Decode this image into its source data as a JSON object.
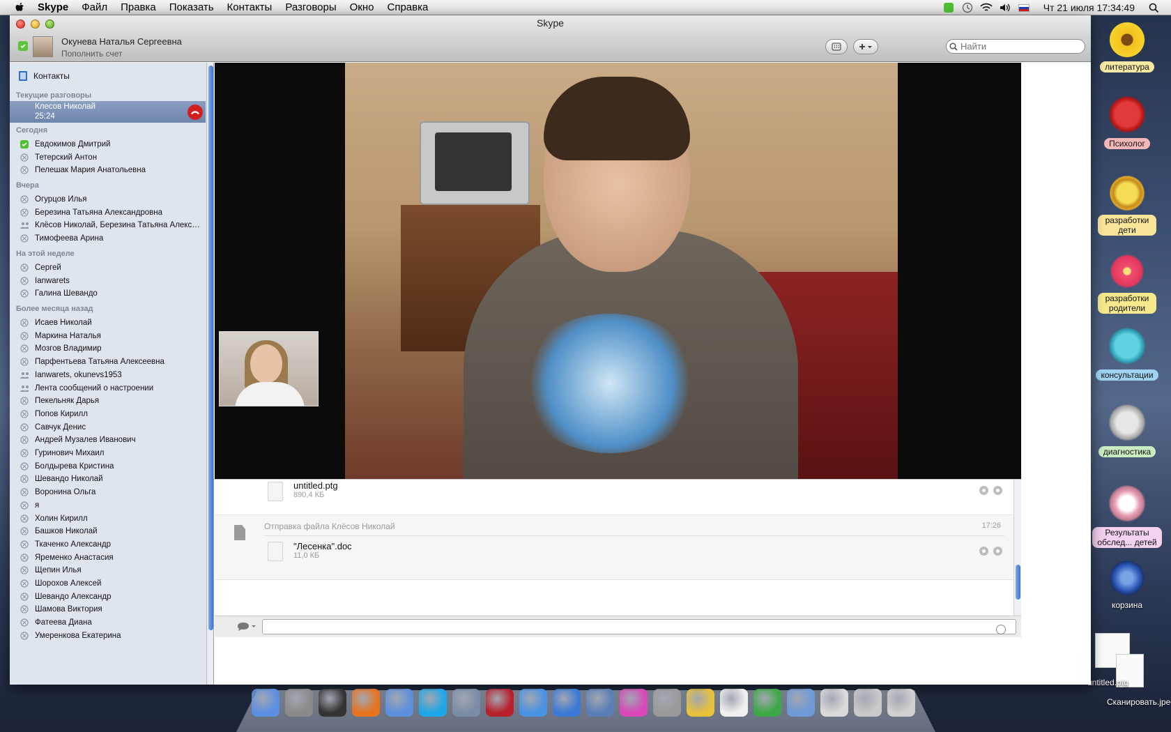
{
  "menubar": {
    "app_name": "Skype",
    "items": [
      "Файл",
      "Правка",
      "Показать",
      "Контакты",
      "Разговоры",
      "Окно",
      "Справка"
    ],
    "clock": "Чт 21 июля  17:34:49"
  },
  "window": {
    "title": "Skype",
    "user_name": "Окунева Наталья Сергеевна",
    "user_sub": "Пополнить счет",
    "search_placeholder": "Найти"
  },
  "sidebar": {
    "contacts_label": "Контакты",
    "current_header": "Текущие разговоры",
    "active_call": {
      "name": "Клесов Николай",
      "duration": "25:24"
    },
    "sections": [
      {
        "title": "Сегодня",
        "items": [
          {
            "label": "Евдокимов Дмитрий",
            "icon": "online-status-icon"
          },
          {
            "label": "Тетерский Антон",
            "icon": "call-history-icon"
          },
          {
            "label": "Пелешак Мария Анатольевна",
            "icon": "call-history-icon"
          }
        ]
      },
      {
        "title": "Вчера",
        "items": [
          {
            "label": "Огурцов Илья",
            "icon": "call-history-icon"
          },
          {
            "label": "Березина Татьяна Александровна",
            "icon": "call-history-icon"
          },
          {
            "label": "Клёсов Николай, Березина Татьяна Александровна",
            "icon": "group-chat-icon"
          },
          {
            "label": "Тимофеева Арина",
            "icon": "call-history-icon"
          }
        ]
      },
      {
        "title": "На этой неделе",
        "items": [
          {
            "label": "Сергей",
            "icon": "call-history-icon"
          },
          {
            "label": "Ianwarets",
            "icon": "call-history-icon"
          },
          {
            "label": "Галина Шевандо",
            "icon": "call-history-icon"
          }
        ]
      },
      {
        "title": "Более месяца назад",
        "items": [
          {
            "label": "Исаев Николай",
            "icon": "call-history-icon"
          },
          {
            "label": "Маркина Наталья",
            "icon": "call-history-icon"
          },
          {
            "label": "Мозгов Владимир",
            "icon": "call-history-icon"
          },
          {
            "label": "Парфентьева Татьяна Алексеевна",
            "icon": "call-history-icon"
          },
          {
            "label": "Ianwarets, okunevs1953",
            "icon": "group-chat-icon"
          },
          {
            "label": "Лента сообщений о настроении",
            "icon": "group-chat-icon"
          },
          {
            "label": "Пекельняк Дарья",
            "icon": "call-history-icon"
          },
          {
            "label": "Попов Кирилл",
            "icon": "call-history-icon"
          },
          {
            "label": "Савчук Денис",
            "icon": "call-history-icon"
          },
          {
            "label": "Андрей Музалев Иванович",
            "icon": "call-history-icon"
          },
          {
            "label": "Гуринович Михаил",
            "icon": "call-history-icon"
          },
          {
            "label": "Болдырева Кристина",
            "icon": "call-history-icon"
          },
          {
            "label": "Шевандо Николай",
            "icon": "call-history-icon"
          },
          {
            "label": "Воронина Ольга",
            "icon": "call-history-icon"
          },
          {
            "label": "я",
            "icon": "call-history-icon"
          },
          {
            "label": "Холин Кирилл",
            "icon": "call-history-icon"
          },
          {
            "label": "Башков Николай",
            "icon": "call-history-icon"
          },
          {
            "label": "Ткаченко Александр",
            "icon": "call-history-icon"
          },
          {
            "label": "Яременко Анастасия",
            "icon": "call-history-icon"
          },
          {
            "label": "Щепин Илья",
            "icon": "call-history-icon"
          },
          {
            "label": "Шорохов Алексей",
            "icon": "call-history-icon"
          },
          {
            "label": "Шевандо Александр",
            "icon": "call-history-icon"
          },
          {
            "label": "Шамова Виктория",
            "icon": "call-history-icon"
          },
          {
            "label": "Фатеева Диана",
            "icon": "call-history-icon"
          },
          {
            "label": "Умеренкова Екатерина",
            "icon": "call-history-icon"
          }
        ]
      }
    ]
  },
  "chat": {
    "file1": {
      "name": "untitled.ptg",
      "size": "890,4 КБ"
    },
    "event": {
      "title": "Отправка файла Клёсов Николай",
      "time": "17:26"
    },
    "file2": {
      "name": "\"Лесенка\".doc",
      "size": "11,0 КБ"
    }
  },
  "desktop_icons": [
    {
      "label": "литература",
      "icon": "sunflower-icon",
      "color": "#f5d22c",
      "bg": "#f9e9a5"
    },
    {
      "label": "Психолог",
      "icon": "red-cat-icon",
      "color": "#d32424",
      "bg": "#f5b8b8"
    },
    {
      "label": "разработки дети",
      "icon": "lion-icon",
      "color": "#e0a728",
      "bg": "#f7e59a"
    },
    {
      "label": "разработки родители",
      "icon": "flower-icon",
      "color": "#e0375d",
      "bg": "#f6e98d"
    },
    {
      "label": "консультации",
      "icon": "blue-cat-icon",
      "color": "#37b4c9",
      "bg": "#9fd3f0"
    },
    {
      "label": "диагностика",
      "icon": "grey-cat-icon",
      "color": "#a4a4a4",
      "bg": "#c9ecc0"
    },
    {
      "label": "Результаты обслед... детей",
      "icon": "bear-icon",
      "color": "#e9a3b6",
      "bg": "#f2d2ee"
    },
    {
      "label": "корзина",
      "icon": "blue-flower-icon",
      "color": "#2c58b4",
      "bg": "transparent"
    }
  ],
  "desktop_files": {
    "file1": "untitled.ptg",
    "file2": "Сканировать.jpeg"
  },
  "dock_icons": [
    {
      "name": "finder-icon",
      "color": "#5b8fe2"
    },
    {
      "name": "system-prefs-icon",
      "color": "#8a8a8a"
    },
    {
      "name": "dashboard-icon",
      "color": "#333333"
    },
    {
      "name": "firefox-icon",
      "color": "#e8731f"
    },
    {
      "name": "facetime-icon",
      "color": "#5c8fdc"
    },
    {
      "name": "skype-icon",
      "color": "#1ea7e8"
    },
    {
      "name": "mail-icon",
      "color": "#7b8da6"
    },
    {
      "name": "photobooth-icon",
      "color": "#b8202a"
    },
    {
      "name": "mail-app-icon",
      "color": "#4a92e4"
    },
    {
      "name": "itunes-icon",
      "color": "#3a7ad6"
    },
    {
      "name": "preview-icon",
      "color": "#5a7fb8"
    },
    {
      "name": "gamecenter-icon",
      "color": "#d947b8"
    },
    {
      "name": "imovie-icon",
      "color": "#9a9a9a"
    },
    {
      "name": "yellow-cat-icon",
      "color": "#e8c13a"
    },
    {
      "name": "daisy-icon",
      "color": "#f0f0f0"
    },
    {
      "name": "green-cat-icon",
      "color": "#3ca846"
    },
    {
      "name": "applications-folder-icon",
      "color": "#6e9ad8"
    },
    {
      "name": "documents-stack-icon",
      "color": "#dadada"
    },
    {
      "name": "downloads-stack-icon",
      "color": "#c9c9c9"
    },
    {
      "name": "trash-icon",
      "color": "#d0d0d0"
    }
  ]
}
